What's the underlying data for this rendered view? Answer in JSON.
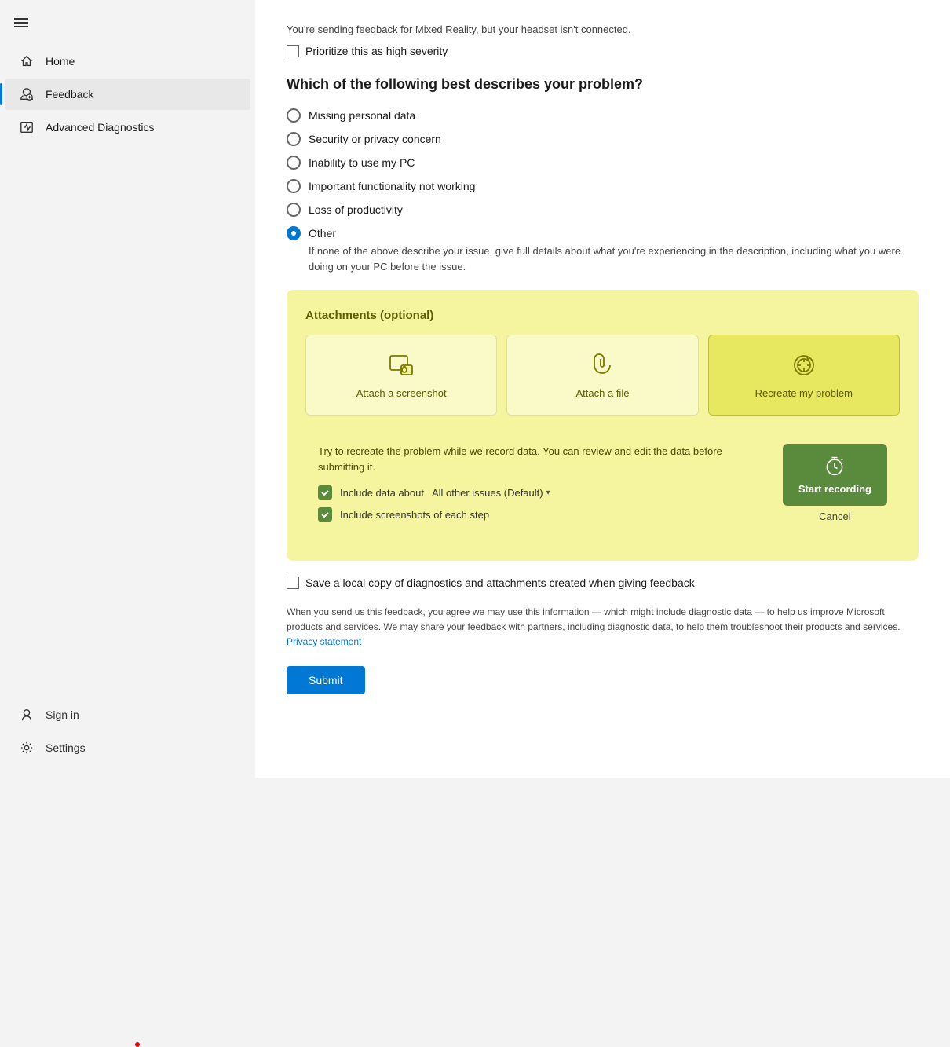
{
  "sidebar": {
    "menu_icon_label": "Menu",
    "items": [
      {
        "id": "home",
        "label": "Home",
        "active": false
      },
      {
        "id": "feedback",
        "label": "Feedback",
        "active": true
      },
      {
        "id": "advanced-diagnostics",
        "label": "Advanced Diagnostics",
        "active": false
      }
    ],
    "bottom_items": [
      {
        "id": "sign-in",
        "label": "Sign in"
      },
      {
        "id": "settings",
        "label": "Settings"
      }
    ]
  },
  "main": {
    "info_text": "You're sending feedback for Mixed Reality, but your headset isn't connected.",
    "priority_checkbox_label": "Prioritize this as high severity",
    "section_title": "Which of the following best describes your problem?",
    "radio_options": [
      {
        "id": "missing-personal-data",
        "label": "Missing personal data",
        "selected": false
      },
      {
        "id": "security-privacy",
        "label": "Security or privacy concern",
        "selected": false
      },
      {
        "id": "inability-use-pc",
        "label": "Inability to use my PC",
        "selected": false
      },
      {
        "id": "important-functionality",
        "label": "Important functionality not working",
        "selected": false
      },
      {
        "id": "loss-productivity",
        "label": "Loss of productivity",
        "selected": false
      },
      {
        "id": "other",
        "label": "Other",
        "selected": true
      }
    ],
    "other_description": "If none of the above describe your issue, give full details about what you're experiencing in the description, including what you were doing on your PC before the issue.",
    "attachments": {
      "title": "Attachments (optional)",
      "buttons": [
        {
          "id": "attach-screenshot",
          "label": "Attach a screenshot"
        },
        {
          "id": "attach-file",
          "label": "Attach a file"
        },
        {
          "id": "recreate-problem",
          "label": "Recreate my problem",
          "active": true
        }
      ],
      "recreate": {
        "description": "Try to recreate the problem while we record data. You can review and edit the data before submitting it.",
        "include_data_label": "Include data about",
        "include_data_value": "All other issues (Default)",
        "include_screenshots_label": "Include screenshots of each step",
        "start_recording_label": "Start recording",
        "cancel_label": "Cancel"
      }
    },
    "local_copy_label": "Save a local copy of diagnostics and attachments created when giving feedback",
    "privacy_text": "When you send us this feedback, you agree we may use this information — which might include diagnostic data — to help us improve Microsoft products and services. We may share your feedback with partners, including diagnostic data, to help them troubleshoot their products and services.",
    "privacy_link_text": "Privacy statement",
    "submit_label": "Submit"
  }
}
